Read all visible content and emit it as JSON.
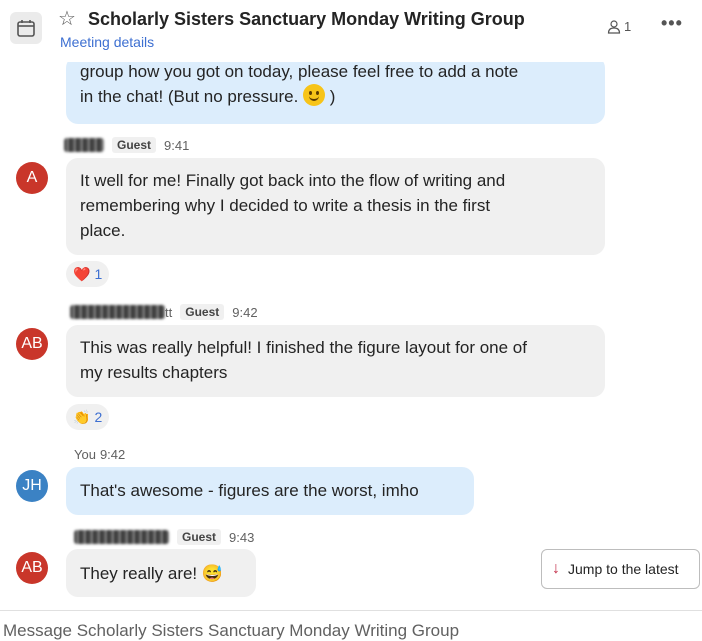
{
  "header": {
    "title": "Scholarly Sisters Sanctuary Monday Writing Group",
    "subtitle": "Meeting details",
    "participant_count": "1",
    "more_label": "•••"
  },
  "messages": [
    {
      "sender": "me",
      "lines": [
        "group how you got on today, please feel free to add a note",
        "in the chat! (But no pressure.",
        ")"
      ]
    },
    {
      "avatar": "A",
      "badge": "Guest",
      "time": "9:41",
      "lines": [
        "It well for me! Finally got back into the flow of writing and",
        "remembering why I decided to write a thesis in the first",
        "place."
      ],
      "reaction": {
        "emoji": "❤️",
        "count": "1"
      }
    },
    {
      "avatar": "AB",
      "name_suffix": "tt",
      "badge": "Guest",
      "time": "9:42",
      "lines": [
        "This was really helpful! I finished the figure layout for one of",
        "my results chapters"
      ],
      "reaction": {
        "emoji": "👏",
        "count": "2"
      }
    },
    {
      "avatar": "JH",
      "sender_label": "You",
      "time": "9:42",
      "lines": [
        "That's awesome - figures are the worst, imho"
      ]
    },
    {
      "avatar": "AB",
      "badge": "Guest",
      "time": "9:43",
      "lines": [
        "They really are! 😅"
      ]
    }
  ],
  "jump_label": "Jump to the latest",
  "composer": {
    "placeholder": "Message Scholarly Sisters Sanctuary Monday Writing Group"
  },
  "colors": {
    "accent": "#3d6fd1",
    "avatar_red": "#c9362a",
    "avatar_blue": "#3b82c4",
    "mine_bubble": "#dcedfc",
    "other_bubble": "#f0f0f0"
  }
}
